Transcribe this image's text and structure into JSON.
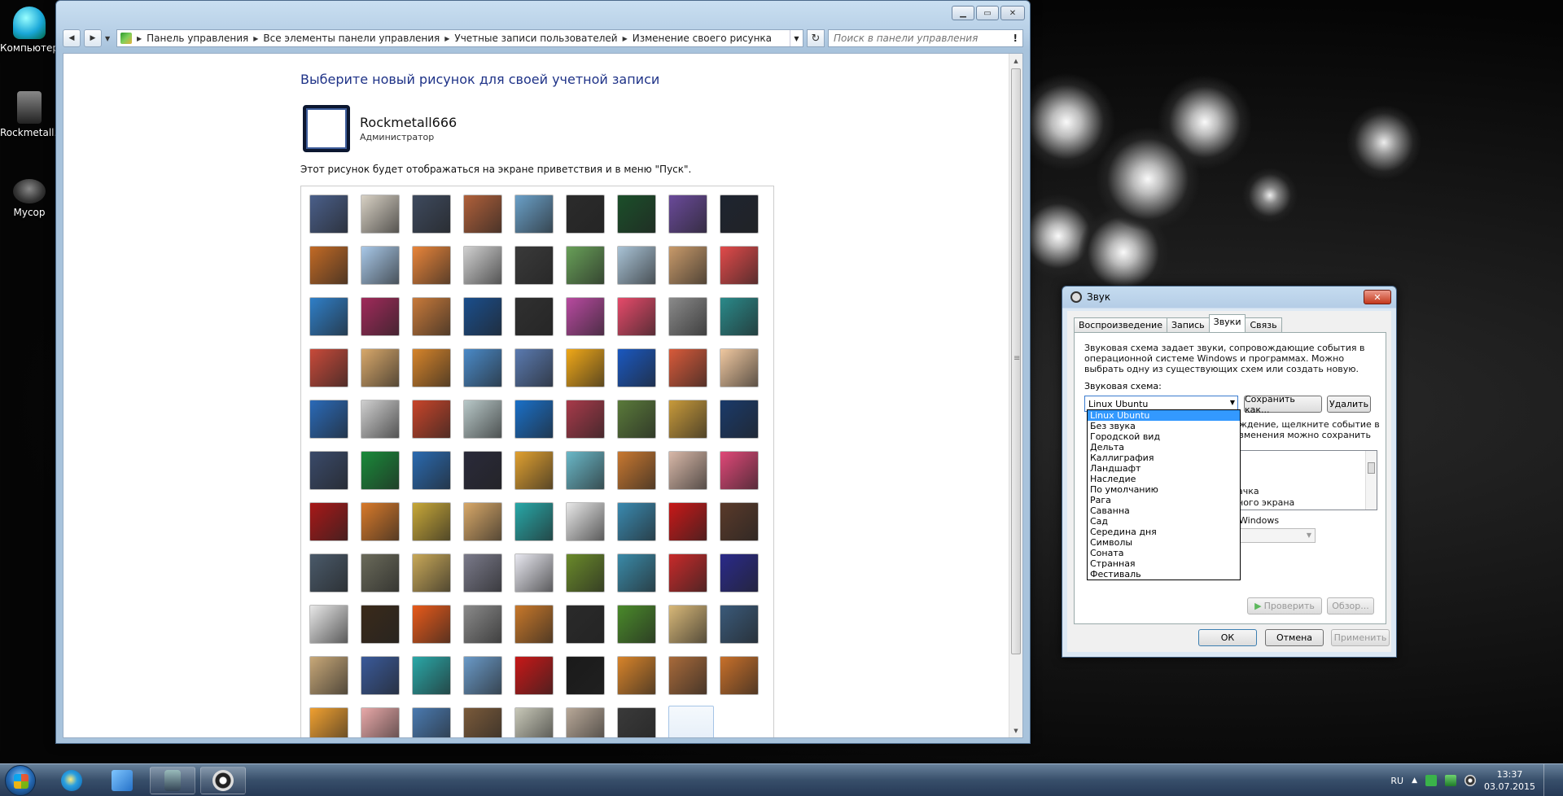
{
  "desktop": {
    "icons": [
      {
        "label": "Компьютер"
      },
      {
        "label": "Rockmetall..."
      },
      {
        "label": "Мусор"
      }
    ]
  },
  "cp_window": {
    "breadcrumbs": [
      "Панель управления",
      "Все элементы панели управления",
      "Учетные записи пользователей",
      "Изменение своего рисунка"
    ],
    "search_placeholder": "Поиск в панели управления",
    "page_title": "Выберите новый рисунок для своей учетной записи",
    "user_name": "Rockmetall666",
    "user_role": "Администратор",
    "hint": "Этот рисунок будет отображаться на экране приветствия и в меню \"Пуск\".",
    "pictures": [
      "#4a5f8a",
      "#d8d1c4",
      "#3e4a5e",
      "#b0603a",
      "#6aa0c8",
      "#2b2b2b",
      "#1b4f2a",
      "#6a4a9a",
      "#1e2430",
      "#c26a25",
      "#a8c8e8",
      "#e9853a",
      "#d0d0d0",
      "#3a3a3a",
      "#68a058",
      "#a9c3d6",
      "#c89a6a",
      "#e24a4a",
      "#2f7fc8",
      "#a02a5a",
      "#c87a3a",
      "#1a4e8c",
      "#303030",
      "#b84aa0",
      "#e64a6a",
      "#8a8a8a",
      "#2a8a8a",
      "#c84a3a",
      "#d8a86a",
      "#d6842a",
      "#4a8ac8",
      "#5a7ab0",
      "#f0a818",
      "#1a58c0",
      "#d85a3a",
      "#f0c8a0",
      "#2a6ab8",
      "#cfcfcf",
      "#c8452a",
      "#b8c8c8",
      "#1a70c8",
      "#a83a4a",
      "#5a7a3a",
      "#c89a3a",
      "#1a3a6a",
      "#3a4a6a",
      "#1a8a3a",
      "#2a6ab0",
      "#2a2a3a",
      "#e0a030",
      "#6ab8c8",
      "#c87830",
      "#d8b8a8",
      "#e04878",
      "#a81818",
      "#d87a2a",
      "#c8a838",
      "#d8a868",
      "#28a8a8",
      "#e8e8e8",
      "#3a8ab0",
      "#c81818",
      "#5a3a2a",
      "#4a5a6a",
      "#6a6a5a",
      "#c8a858",
      "#7a7a8a",
      "#e8e8f0",
      "#6a8a2a",
      "#3a8aa8",
      "#c82a2a",
      "#2a2a8a",
      "#e8e8e8",
      "#3a2a1a",
      "#e85a1a",
      "#8a8a8a",
      "#c8782a",
      "#2a2a2a",
      "#4a8a2a",
      "#d8b878",
      "#3a5a7a",
      "#c8a878",
      "#3a5a9a",
      "#2aa8a8",
      "#6a9ac8",
      "#c81818",
      "#1a1a1a",
      "#d8842a",
      "#a86a3a",
      "#c8702a",
      "#f0a030",
      "#e8a8a8",
      "#4a7ab0",
      "#7a5a3a",
      "#c8c8b8",
      "#b8a898",
      "#3a3a3a"
    ]
  },
  "sound_dialog": {
    "title": "Звук",
    "tabs": [
      "Воспроизведение",
      "Запись",
      "Звуки",
      "Связь"
    ],
    "description": "Звуковая схема задает звуки, сопровождающие события в операционной системе Windows и программах. Можно выбрать одну из существующих схем или создать новую.",
    "scheme_label": "Звуковая схема:",
    "scheme_value": "Linux Ubuntu",
    "save_as": "Сохранить как...",
    "delete": "Удалить",
    "partial_lines": [
      "ждение, щелкните событие в",
      "зменения можно сохранить",
      "ачка",
      "ного экрана",
      "Windows"
    ],
    "test": "Проверить",
    "browse": "Обзор...",
    "ok": "ОК",
    "cancel": "Отмена",
    "apply": "Применить",
    "scheme_options": [
      "Linux Ubuntu",
      "Без звука",
      "Городской вид",
      "Дельта",
      "Каллиграфия",
      "Ландшафт",
      "Наследие",
      "По умолчанию",
      "Рага",
      "Саванна",
      "Сад",
      "Середина дня",
      "Символы",
      "Соната",
      "Странная",
      "Фестиваль"
    ]
  },
  "taskbar": {
    "lang": "RU",
    "time": "13:37",
    "date": "03.07.2015"
  }
}
